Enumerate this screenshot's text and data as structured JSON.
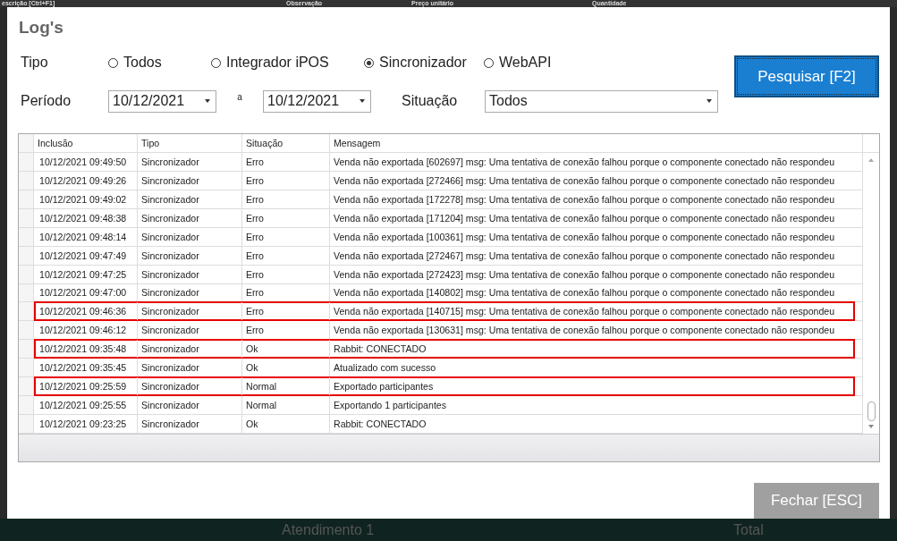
{
  "background": {
    "header_columns": [
      "escrição [Ctrl+F1]",
      "Observação",
      "Preço unitário",
      "Quantidade"
    ],
    "footer_texts": [
      "Atendimento 1",
      "Total"
    ]
  },
  "dialog": {
    "title": "Log's"
  },
  "filters": {
    "tipo_label": "Tipo",
    "tipo_options": [
      {
        "label": "Todos",
        "selected": false
      },
      {
        "label": "Integrador iPOS",
        "selected": false
      },
      {
        "label": "Sincronizador",
        "selected": true
      },
      {
        "label": "WebAPI",
        "selected": false
      }
    ],
    "periodo_label": "Período",
    "date_from": "10/12/2021",
    "separator": "a",
    "date_to": "10/12/2021",
    "situacao_label": "Situação",
    "situacao_value": "Todos"
  },
  "search_button": "Pesquisar [F2]",
  "table": {
    "columns": [
      "Inclusão",
      "Tipo",
      "Situação",
      "Mensagem"
    ],
    "rows": [
      {
        "cells": [
          "10/12/2021 09:49:50",
          "Sincronizador",
          "Erro",
          "Venda não exportada [602697] msg: Uma tentativa de conexão falhou porque o componente conectado não respondeu"
        ],
        "highlighted": false
      },
      {
        "cells": [
          "10/12/2021 09:49:26",
          "Sincronizador",
          "Erro",
          "Venda não exportada [272466] msg: Uma tentativa de conexão falhou porque o componente conectado não respondeu"
        ],
        "highlighted": false
      },
      {
        "cells": [
          "10/12/2021 09:49:02",
          "Sincronizador",
          "Erro",
          "Venda não exportada [172278] msg: Uma tentativa de conexão falhou porque o componente conectado não respondeu"
        ],
        "highlighted": false
      },
      {
        "cells": [
          "10/12/2021 09:48:38",
          "Sincronizador",
          "Erro",
          "Venda não exportada [171204] msg: Uma tentativa de conexão falhou porque o componente conectado não respondeu"
        ],
        "highlighted": false
      },
      {
        "cells": [
          "10/12/2021 09:48:14",
          "Sincronizador",
          "Erro",
          "Venda não exportada [100361] msg: Uma tentativa de conexão falhou porque o componente conectado não respondeu"
        ],
        "highlighted": false
      },
      {
        "cells": [
          "10/12/2021 09:47:49",
          "Sincronizador",
          "Erro",
          "Venda não exportada [272467] msg: Uma tentativa de conexão falhou porque o componente conectado não respondeu"
        ],
        "highlighted": false
      },
      {
        "cells": [
          "10/12/2021 09:47:25",
          "Sincronizador",
          "Erro",
          "Venda não exportada [272423] msg: Uma tentativa de conexão falhou porque o componente conectado não respondeu"
        ],
        "highlighted": false
      },
      {
        "cells": [
          "10/12/2021 09:47:00",
          "Sincronizador",
          "Erro",
          "Venda não exportada [140802] msg: Uma tentativa de conexão falhou porque o componente conectado não respondeu"
        ],
        "highlighted": false
      },
      {
        "cells": [
          "10/12/2021 09:46:36",
          "Sincronizador",
          "Erro",
          "Venda não exportada [140715] msg: Uma tentativa de conexão falhou porque o componente conectado não respondeu"
        ],
        "highlighted": true
      },
      {
        "cells": [
          "10/12/2021 09:46:12",
          "Sincronizador",
          "Erro",
          "Venda não exportada [130631] msg: Uma tentativa de conexão falhou porque o componente conectado não respondeu"
        ],
        "highlighted": false
      },
      {
        "cells": [
          "10/12/2021 09:35:48",
          "Sincronizador",
          "Ok",
          "Rabbit: CONECTADO"
        ],
        "highlighted": true
      },
      {
        "cells": [
          "10/12/2021 09:35:45",
          "Sincronizador",
          "Ok",
          "Atualizado com sucesso"
        ],
        "highlighted": false
      },
      {
        "cells": [
          "10/12/2021 09:25:59",
          "Sincronizador",
          "Normal",
          "Exportado participantes"
        ],
        "highlighted": true
      },
      {
        "cells": [
          "10/12/2021 09:25:55",
          "Sincronizador",
          "Normal",
          "Exportando 1 participantes"
        ],
        "highlighted": false
      },
      {
        "cells": [
          "10/12/2021 09:23:25",
          "Sincronizador",
          "Ok",
          "Rabbit: CONECTADO"
        ],
        "highlighted": false
      }
    ]
  },
  "close_button": "Fechar [ESC]"
}
